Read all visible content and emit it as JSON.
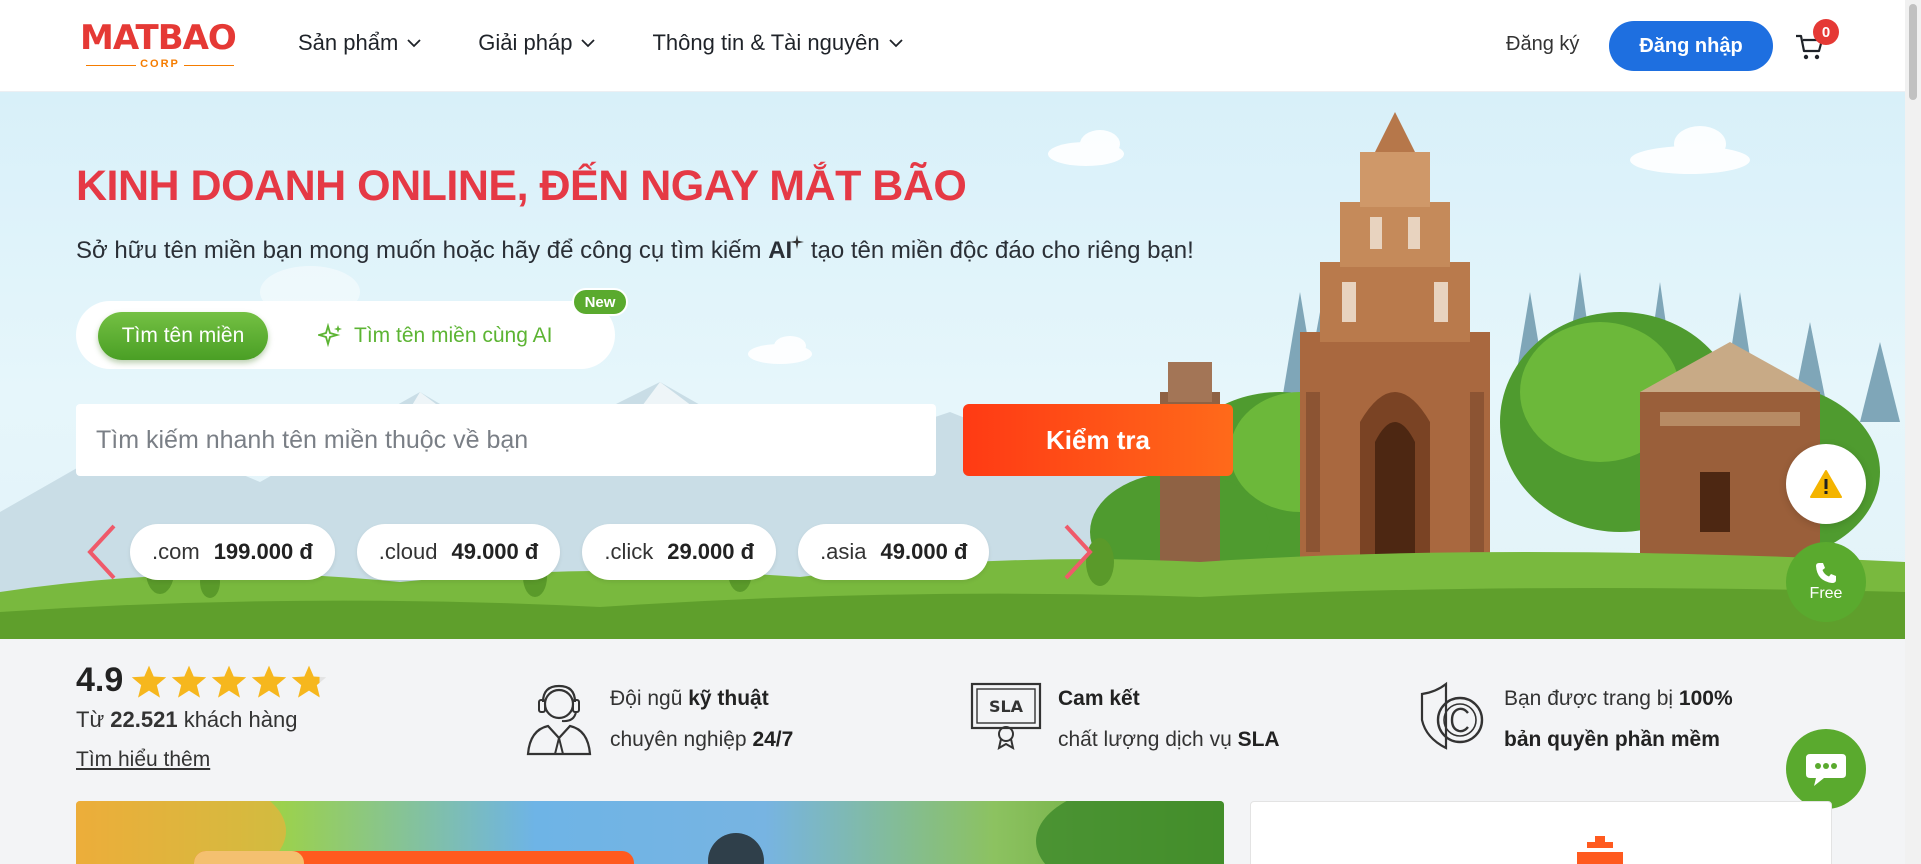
{
  "header": {
    "logo_text": "MATBAO",
    "logo_sub": "CORP",
    "nav": [
      {
        "label": "Sản phẩm"
      },
      {
        "label": "Giải pháp"
      },
      {
        "label": "Thông tin & Tài nguyên"
      }
    ],
    "signup_label": "Đăng ký",
    "login_label": "Đăng nhập",
    "cart_count": "0"
  },
  "hero": {
    "title": "KINH DOANH ONLINE, ĐẾN NGAY MẮT BÃO",
    "subtitle_before": "Sở hữu tên miền bạn mong muốn hoặc hãy để công cụ tìm kiếm ",
    "subtitle_ai": "AI",
    "subtitle_after": " tạo tên miền độc đáo cho riêng bạn!",
    "tab_domain": "Tìm tên miền",
    "tab_ai": "Tìm tên miền cùng AI",
    "new_badge": "New",
    "search_placeholder": "Tìm kiếm nhanh tên miền thuộc về bạn",
    "check_label": "Kiểm tra",
    "pills": [
      {
        "tld": ".com",
        "price": "199.000 đ"
      },
      {
        "tld": ".cloud",
        "price": "49.000 đ"
      },
      {
        "tld": ".click",
        "price": "29.000 đ"
      },
      {
        "tld": ".asia",
        "price": "49.000 đ"
      }
    ],
    "free_label": "Free"
  },
  "stats": {
    "rating": "4.9",
    "stars_rating": 4.8,
    "customers_prefix": "Từ ",
    "customers_count": "22.521",
    "customers_suffix": " khách hàng",
    "learn_more": "Tìm hiểu thêm",
    "features": [
      {
        "line1_plain": "Đội ngũ ",
        "line1_bold": "kỹ thuật",
        "line2_plain": "chuyên nghiệp ",
        "line2_bold": "24/7",
        "icon": "support-agent-icon"
      },
      {
        "line1_plain": "",
        "line1_bold": "Cam kết",
        "line2_plain": "chất lượng dịch vụ ",
        "line2_bold": "SLA",
        "icon": "sla-certificate-icon"
      },
      {
        "line1_plain": "Bạn được trang bị ",
        "line1_bold": "100%",
        "line2_plain": "",
        "line2_bold": "bản quyền phần mềm",
        "icon": "copyright-shield-icon"
      }
    ]
  },
  "colors": {
    "brand_red": "#e53945",
    "primary_blue": "#1e6fe0",
    "green": "#5aaa2e",
    "orange": "#ff4b16"
  }
}
